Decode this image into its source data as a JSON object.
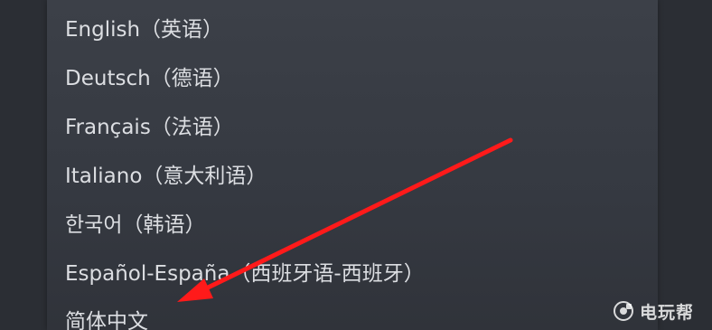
{
  "language_menu": {
    "items": [
      {
        "label": "English（英语）"
      },
      {
        "label": "Deutsch（德语）"
      },
      {
        "label": "Français（法语）"
      },
      {
        "label": "Italiano（意大利语）"
      },
      {
        "label": "한국어（韩语）"
      },
      {
        "label": "Español-España（西班牙语-西班牙）"
      },
      {
        "label": "简体中文"
      }
    ]
  },
  "annotation": {
    "arrow_color": "#ff1a1a",
    "arrow_target": "简体中文"
  },
  "watermark": {
    "text": "电玩帮",
    "icon": "game-controller-logo"
  }
}
